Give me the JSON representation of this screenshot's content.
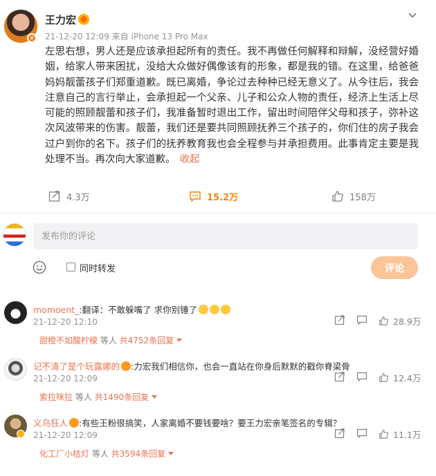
{
  "post": {
    "username": "王力宏",
    "meta": "21-12-20 12:09  来自 iPhone 13 Pro Max",
    "body": "左思右想，男人还是应该承担起所有的责任。我不再做任何解释和辩解，没经营好婚姻，给家人带来困扰，没给大众做好偶像该有的形象，都是我的错。在这里，给爸爸妈妈靓蕾孩子们郑重道歉。既已离婚，争论过去种种已经无意义了。从今往后，我会注意自己的言行举止，会承担起一个父亲、儿子和公众人物的责任，经济上生活上尽可能的照顾靓蕾和孩子们，我准备暂时退出工作，留出时间陪伴父母和孩子，弥补这次风波带来的伤害。靓蕾，我们还是要共同照顾抚养三个孩子的，你们住的房子我会过户到你的名下。孩子们的抚养教育我也会全程参与并承担费用。此事肯定主要是我处理不当。再次向大家道歉。",
    "collapse_label": "收起",
    "reposts": "4.3万",
    "comments": "15.2万",
    "likes": "158万"
  },
  "composer": {
    "placeholder": "发布你的评论",
    "forward_label": "同时转发",
    "submit_label": "评论"
  },
  "comments": [
    {
      "user": "momoent_",
      "text": ":翻译：不敢躲嘴了 求你别锤了",
      "time": "21-12-20 12:10",
      "likes": "28.9万",
      "reply_user": "甜橙不如酸柠檬",
      "reply_mid": " 等人 ",
      "reply_count": "共4752条回复"
    },
    {
      "user": "记不清了是个玩露娜的",
      "text": ":力宏我们相信你，也会一直站在你身后默默的戳你脊梁骨",
      "time": "21-12-20 12:09",
      "likes": "12.4万",
      "reply_user": "索拉咪拉",
      "reply_mid": " 等人 ",
      "reply_count": "共1490条回复"
    },
    {
      "user": "义乌狂人",
      "text": ":有些王粉很搞笑，人家离婚不要钱要啥？要王力宏亲笔签名的专辑？",
      "time": "21-12-20 12:09",
      "likes": "11.1万",
      "reply_user": "化工厂小桔灯",
      "reply_mid": " 等人 ",
      "reply_count": "共3594条回复"
    }
  ],
  "colors": {
    "accent": "#ff8200",
    "link": "#eb7350",
    "submit_bg": "#fcc497"
  }
}
